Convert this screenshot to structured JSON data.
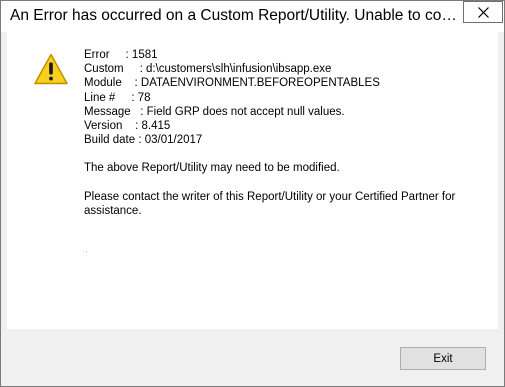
{
  "window": {
    "title": "An Error has occurred on a Custom Report/Utility. Unable to contin..."
  },
  "icons": {
    "warning": "warning-icon",
    "close": "close-icon"
  },
  "error": {
    "fields": [
      {
        "label": "Error     ",
        "value": ": 1581"
      },
      {
        "label": "Custom     ",
        "value": ": d:\\customers\\slh\\infusion\\ibsapp.exe"
      },
      {
        "label": "Module    ",
        "value": ": DATAENVIRONMENT.BEFOREOPENTABLES"
      },
      {
        "label": "Line #     ",
        "value": ": 78"
      },
      {
        "label": "Message   ",
        "value": ": Field GRP does not accept null values."
      },
      {
        "label": "Version    ",
        "value": ": 8.415"
      },
      {
        "label": "Build date ",
        "value": ": 03/01/2017"
      }
    ],
    "note": "The above Report/Utility may need to be modified.",
    "contact": "Please contact the writer of this Report/Utility or your Certified Partner for assistance."
  },
  "buttons": {
    "exit": "Exit"
  },
  "colors": {
    "warning_fill": "#f8d11f",
    "warning_stroke": "#c09000"
  }
}
